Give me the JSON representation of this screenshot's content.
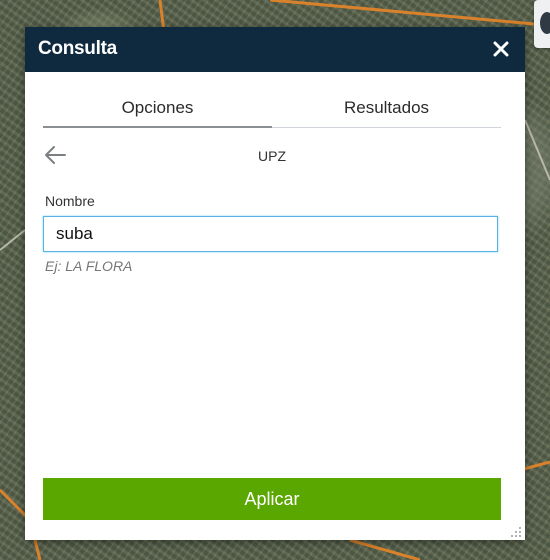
{
  "panel": {
    "title": "Consulta",
    "close_icon": "close-icon"
  },
  "tabs": [
    {
      "label": "Opciones",
      "active": true
    },
    {
      "label": "Resultados",
      "active": false
    }
  ],
  "view": {
    "back_icon": "arrow-left-icon",
    "title": "UPZ"
  },
  "form": {
    "field_label": "Nombre",
    "field_value": "suba",
    "field_hint": "Ej: LA FLORA"
  },
  "actions": {
    "apply_label": "Aplicar"
  },
  "colors": {
    "header_bg": "#0f2a3f",
    "apply_bg": "#5aa700",
    "input_focus_border": "#58b2e3"
  }
}
